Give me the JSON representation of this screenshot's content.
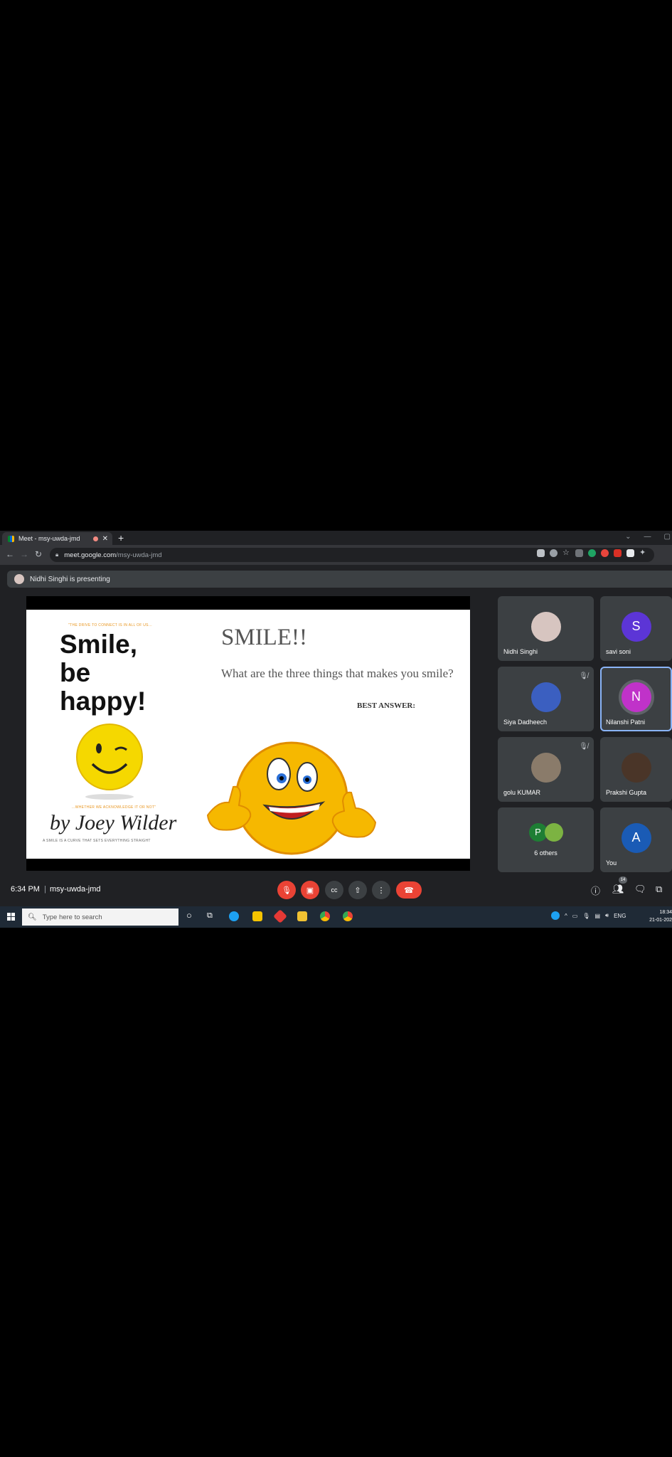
{
  "browser": {
    "tab_title": "Meet - msy-uwda-jmd",
    "new_tab": "+",
    "url_host": "meet.google.com",
    "url_path": "/msy-uwda-jmd"
  },
  "presenting": {
    "text": "Nidhi Singhi is presenting"
  },
  "slide": {
    "book_tagline_top": "\"THE DRIVE TO CONNECT IS IN ALL OF US...",
    "book_title_lines": [
      "Smile,",
      "be",
      "happy!"
    ],
    "book_tagline_bottom": "...WHETHER WE ACKNOWLEDGE IT OR NOT\"",
    "book_author": "by Joey Wilder",
    "book_subtitle": "A SMILE IS A CURVE THAT SETS EVERYTHING STRAIGHT",
    "title": "SMILE!!",
    "question": "What are the three things that makes you smile?",
    "best_answer": "BEST ANSWER:"
  },
  "participants": [
    {
      "name": "Nidhi Singhi",
      "initial": "",
      "color": "#d7c5c0",
      "muted": false,
      "photo": true
    },
    {
      "name": "savi soni",
      "initial": "S",
      "color": "#5c35d6",
      "muted": false,
      "photo": false
    },
    {
      "name": "Siya Dadheech",
      "initial": "",
      "color": "#3b5fc0",
      "muted": true,
      "photo": true
    },
    {
      "name": "Nilanshi Patni",
      "initial": "N",
      "color": "#c032c9",
      "muted": false,
      "photo": false,
      "active": true
    },
    {
      "name": "golu KUMAR",
      "initial": "",
      "color": "#8a7b6a",
      "muted": true,
      "photo": true
    },
    {
      "name": "Prakshi Gupta",
      "initial": "",
      "color": "#4a3528",
      "muted": false,
      "photo": true
    },
    {
      "name": "6 others",
      "initial": "P",
      "color": "#1e7e34",
      "muted": false,
      "photo": false
    },
    {
      "name": "You",
      "initial": "A",
      "color": "#1a5bb5",
      "muted": false,
      "photo": false
    }
  ],
  "meeting": {
    "time": "6:34 PM",
    "separator": "|",
    "code": "msy-uwda-jmd",
    "people_count": "14"
  },
  "taskbar": {
    "search_placeholder": "Type here to search",
    "lang": "ENG",
    "clock_time": "18:34",
    "clock_date": "21-01-202"
  },
  "colors": {
    "red": "#ea4335",
    "bg": "#202124",
    "tile": "#3c4043",
    "accent": "#8ab4f8"
  }
}
